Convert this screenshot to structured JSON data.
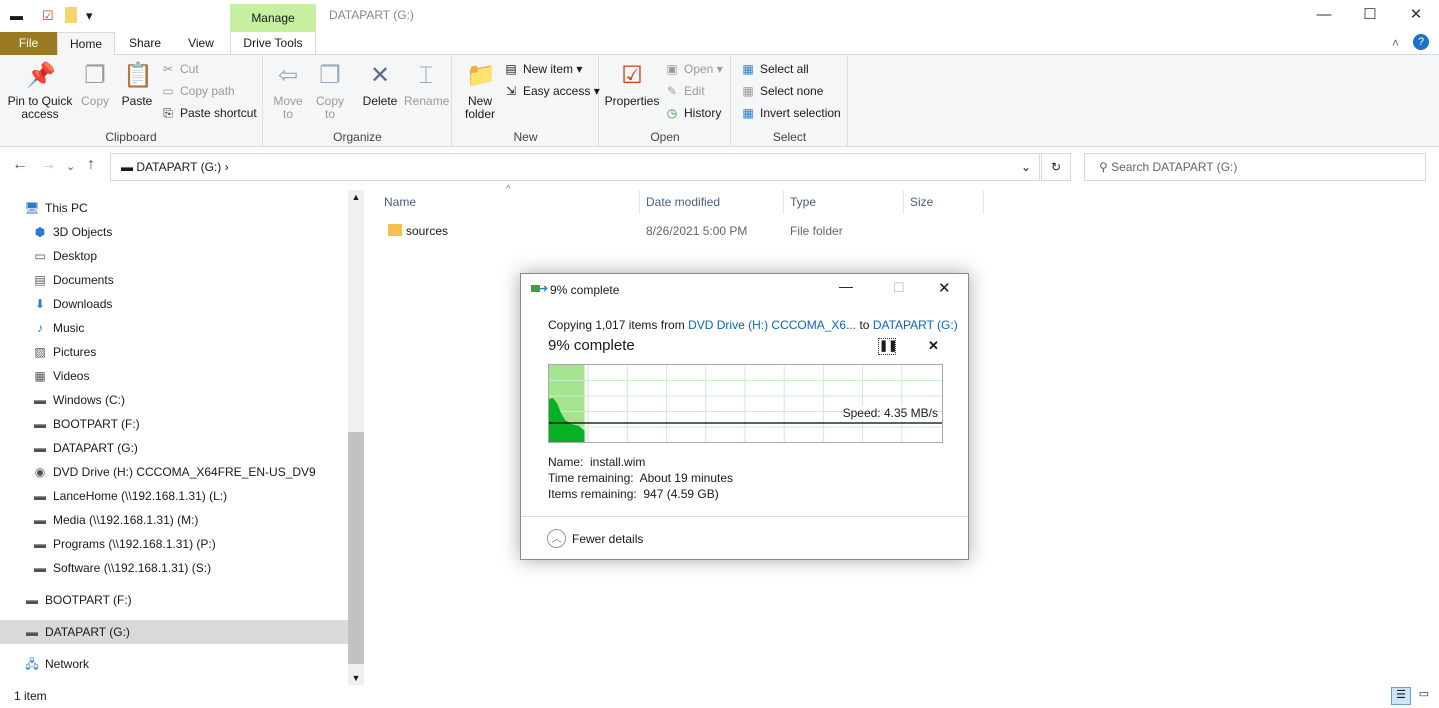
{
  "window": {
    "title": "DATAPART (G:)",
    "context_tab": "Manage",
    "minimize": "—",
    "maximize": "☐",
    "close": "✕"
  },
  "ribbon_tabs": [
    "File",
    "Home",
    "Share",
    "View",
    "Drive Tools"
  ],
  "ribbon": {
    "clipboard": {
      "label": "Clipboard",
      "pin": "Pin to Quick access",
      "copy": "Copy",
      "paste": "Paste",
      "cut": "Cut",
      "copy_path": "Copy path",
      "paste_shortcut": "Paste shortcut"
    },
    "organize": {
      "label": "Organize",
      "move_to": "Move to",
      "copy_to": "Copy to",
      "delete": "Delete",
      "rename": "Rename"
    },
    "new": {
      "label": "New",
      "new_folder": "New folder",
      "new_item": "New item",
      "easy_access": "Easy access"
    },
    "open": {
      "label": "Open",
      "properties": "Properties",
      "open": "Open",
      "edit": "Edit",
      "history": "History"
    },
    "select": {
      "label": "Select",
      "select_all": "Select all",
      "select_none": "Select none",
      "invert": "Invert selection"
    }
  },
  "address": {
    "path": "DATAPART (G:)",
    "search_placeholder": "Search DATAPART (G:)"
  },
  "nav": [
    {
      "label": "This PC",
      "icon": "pc-icon"
    },
    {
      "label": "3D Objects",
      "icon": "cube-icon"
    },
    {
      "label": "Desktop",
      "icon": "desktop-icon"
    },
    {
      "label": "Documents",
      "icon": "document-icon"
    },
    {
      "label": "Downloads",
      "icon": "download-icon"
    },
    {
      "label": "Music",
      "icon": "music-icon"
    },
    {
      "label": "Pictures",
      "icon": "pictures-icon"
    },
    {
      "label": "Videos",
      "icon": "video-icon"
    },
    {
      "label": "Windows (C:)",
      "icon": "drive-icon"
    },
    {
      "label": "BOOTPART (F:)",
      "icon": "drive-icon"
    },
    {
      "label": "DATAPART (G:)",
      "icon": "drive-icon"
    },
    {
      "label": "DVD Drive (H:) CCCOMA_X64FRE_EN-US_DV9",
      "icon": "dvd-icon"
    },
    {
      "label": "LanceHome (\\\\192.168.1.31) (L:)",
      "icon": "network-drive-icon"
    },
    {
      "label": "Media (\\\\192.168.1.31) (M:)",
      "icon": "network-drive-icon"
    },
    {
      "label": "Programs (\\\\192.168.1.31) (P:)",
      "icon": "network-drive-icon"
    },
    {
      "label": "Software (\\\\192.168.1.31) (S:)",
      "icon": "network-drive-icon"
    },
    {
      "label": "BOOTPART (F:)",
      "icon": "drive-icon"
    },
    {
      "label": "DATAPART (G:)",
      "icon": "drive-icon"
    },
    {
      "label": "Network",
      "icon": "network-icon"
    }
  ],
  "columns": [
    "Name",
    "Date modified",
    "Type",
    "Size"
  ],
  "files": [
    {
      "name": "sources",
      "date": "8/26/2021 5:00 PM",
      "type": "File folder",
      "size": ""
    }
  ],
  "status": "1 item",
  "dialog": {
    "title": "9% complete",
    "copying": "Copying 1,017 items from",
    "source": "DVD Drive (H:) CCCOMA_X6...",
    "to": "to",
    "dest": "DATAPART (G:)",
    "heading": "9% complete",
    "progress_percent": 9,
    "speed": "Speed: 4.35 MB/s",
    "name_label": "Name:",
    "name": "install.wim",
    "time_label": "Time remaining:",
    "time": "About 19 minutes",
    "items_label": "Items remaining:",
    "items": "947 (4.59 GB)",
    "fewer": "Fewer details",
    "accent": "#06b025"
  }
}
